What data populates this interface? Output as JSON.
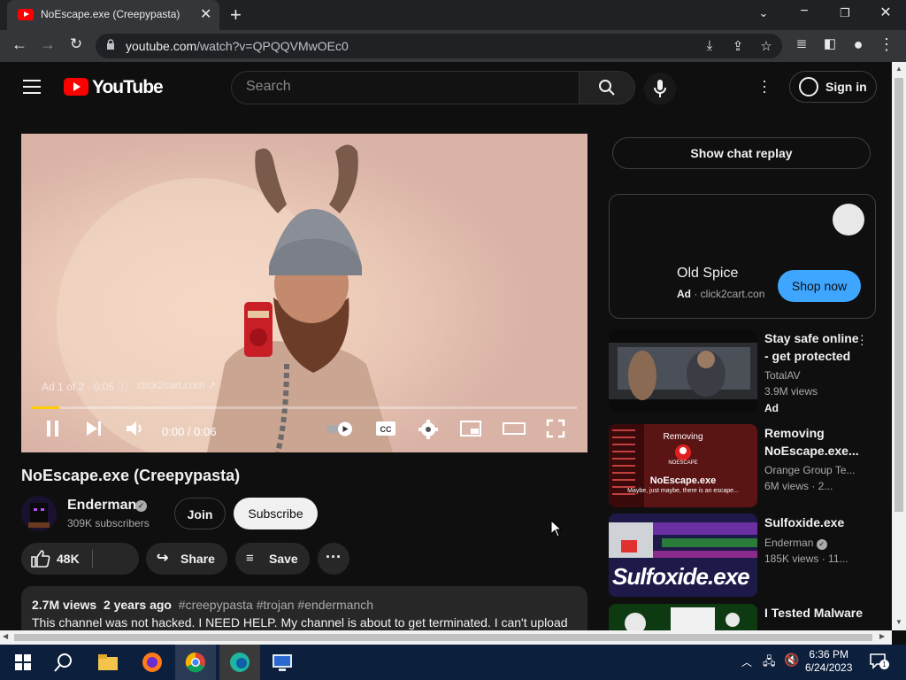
{
  "browser": {
    "tab_title": "NoEscape.exe (Creepypasta)",
    "url_domain": "youtube.com",
    "url_path": "/watch?v=QPQQVMwOEc0"
  },
  "header": {
    "logo_text": "YouTube",
    "search_placeholder": "Search",
    "signin_label": "Sign in"
  },
  "player": {
    "ad_info": "Ad 1 of 2 · 0:05",
    "ad_link": "click2cart.com",
    "time": "0:00 / 0:06",
    "progress": 0.05
  },
  "video": {
    "title": "NoEscape.exe (Creepypasta)",
    "channel": "Enderman",
    "subscribers": "309K subscribers",
    "join_label": "Join",
    "subscribe_label": "Subscribe",
    "likes": "48K",
    "share_label": "Share",
    "save_label": "Save",
    "views": "2.7M views",
    "age": "2 years ago",
    "tags": "#creepypasta #trojan #endermanch",
    "description": "This channel was not hacked. I NEED HELP. My channel is about to get terminated. I can't upload"
  },
  "sidebar": {
    "chat_replay_label": "Show chat replay",
    "ad_card": {
      "brand": "Old Spice",
      "ad_label": "Ad",
      "domain": "click2cart.con",
      "shop_label": "Shop now"
    },
    "recommendations": [
      {
        "title": "Stay safe online - get protected",
        "channel": "TotalAV",
        "views": "3.9M views",
        "extra": "Ad"
      },
      {
        "title": "Removing NoEscape.exe...",
        "channel": "Orange Group Te...",
        "views": "6M views · 2..."
      },
      {
        "title": "Sulfoxide.exe",
        "channel": "Enderman",
        "views": "185K views · 11..."
      },
      {
        "title": "I Tested Malware",
        "channel": "",
        "views": ""
      }
    ],
    "thumb_texts": {
      "removing": "Removing",
      "noescape_logo": "NOESCAPE",
      "noescape": "NoEscape.exe",
      "tagline": "Maybe, just maybe, there is an escape...",
      "sulfoxide": "Sulfoxide.exe"
    }
  },
  "taskbar": {
    "time": "6:36 PM",
    "date": "6/24/2023",
    "notif_count": "1"
  }
}
